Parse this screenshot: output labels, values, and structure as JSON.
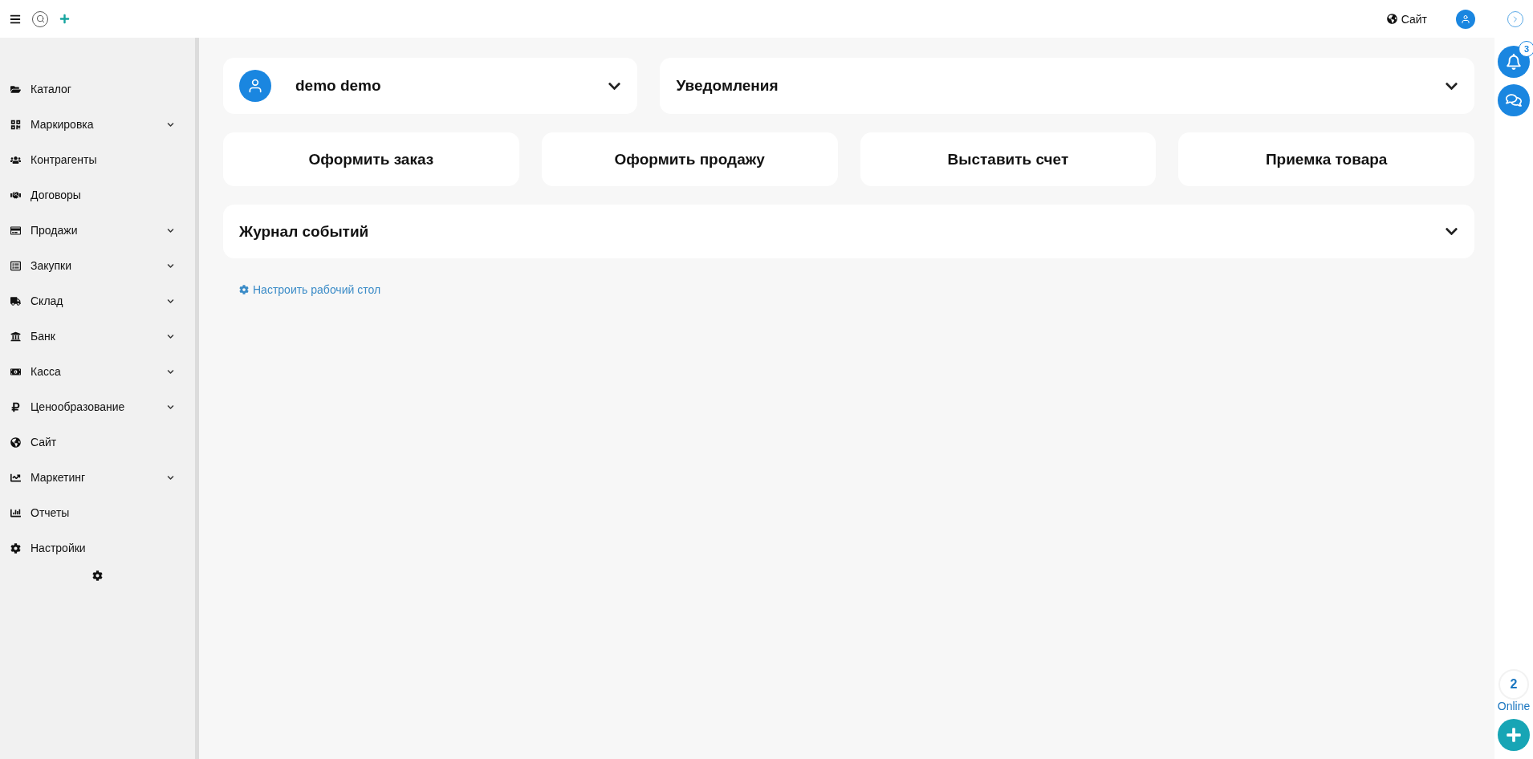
{
  "topbar": {
    "site_link": "Сайт"
  },
  "sidebar": {
    "items": [
      {
        "label": "Каталог",
        "has_submenu": false
      },
      {
        "label": "Маркировка",
        "has_submenu": true
      },
      {
        "label": "Контрагенты",
        "has_submenu": false
      },
      {
        "label": "Договоры",
        "has_submenu": false
      },
      {
        "label": "Продажи",
        "has_submenu": true
      },
      {
        "label": "Закупки",
        "has_submenu": true
      },
      {
        "label": "Склад",
        "has_submenu": true
      },
      {
        "label": "Банк",
        "has_submenu": true
      },
      {
        "label": "Касса",
        "has_submenu": true
      },
      {
        "label": "Ценообразование",
        "has_submenu": true
      },
      {
        "label": "Сайт",
        "has_submenu": false
      },
      {
        "label": "Маркетинг",
        "has_submenu": true
      },
      {
        "label": "Отчеты",
        "has_submenu": false
      },
      {
        "label": "Настройки",
        "has_submenu": false
      }
    ]
  },
  "user_panel": {
    "name": "demo demo",
    "expanded": false
  },
  "notifications_panel": {
    "title": "Уведомления",
    "expanded": false
  },
  "actions": [
    "Оформить заказ",
    "Оформить продажу",
    "Выставить счет",
    "Приемка товара"
  ],
  "journal_panel": {
    "title": "Журнал событий",
    "expanded": false
  },
  "customize_link": "Настроить рабочий стол",
  "right_rail": {
    "notification_count": "3",
    "online_count": "2",
    "online_label": "Online"
  }
}
